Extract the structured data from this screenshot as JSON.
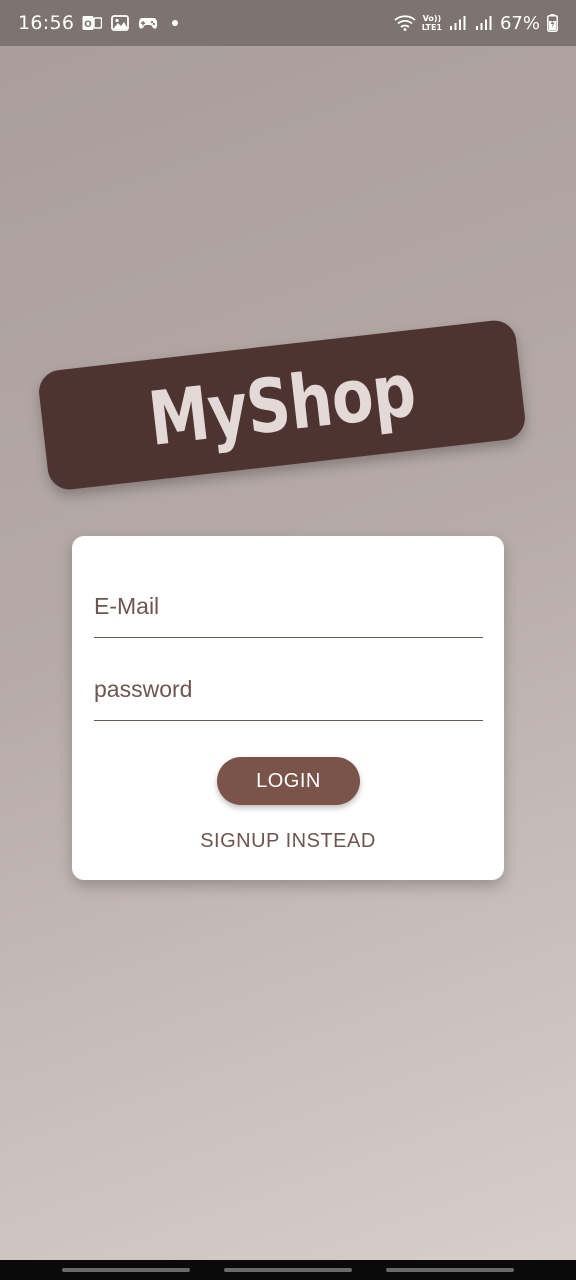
{
  "status_bar": {
    "time": "16:56",
    "battery_percent": "67%",
    "network_label_top": "Vo))",
    "network_label_bottom": "LTE1",
    "notification_icons": [
      "outlook-icon",
      "gallery-icon",
      "game-controller-icon"
    ],
    "status_icons": [
      "wifi-icon",
      "signal-icon",
      "signal-icon",
      "battery-charging-icon"
    ]
  },
  "app": {
    "logo": "MyShop"
  },
  "login_form": {
    "email_placeholder": "E-Mail",
    "email_value": "",
    "password_placeholder": "password",
    "password_value": "",
    "login_label": "LOGIN",
    "signup_label": "SIGNUP INSTEAD"
  },
  "colors": {
    "primary": "#7a5449",
    "logo_background": "#4e3430",
    "text": "#6d5550",
    "card": "#ffffff"
  }
}
